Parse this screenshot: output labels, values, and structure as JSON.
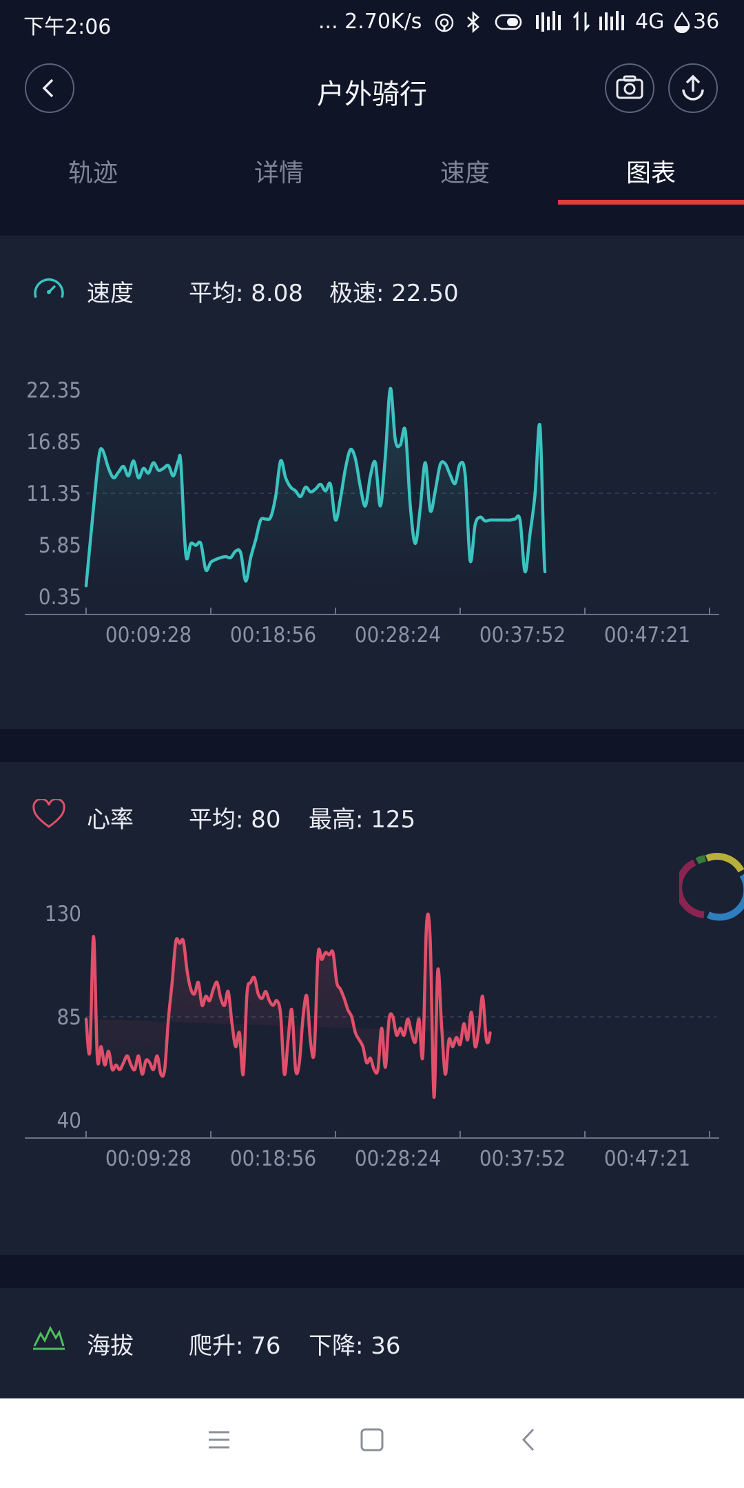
{
  "status_bar": {
    "time": "下午2:06",
    "net_speed": "... 2.70K/s",
    "network": "4G",
    "battery": "36"
  },
  "header": {
    "title": "户外骑行",
    "tabs": [
      {
        "label": "轨迹",
        "active": false
      },
      {
        "label": "详情",
        "active": false
      },
      {
        "label": "速度",
        "active": false
      },
      {
        "label": "图表",
        "active": true
      }
    ]
  },
  "speed_card": {
    "title": "速度",
    "avg": "平均: 8.08",
    "max": "极速: 22.50"
  },
  "heart_card": {
    "title": "心率",
    "avg": "平均: 80",
    "max": "最高: 125"
  },
  "altitude_card": {
    "title": "海拔",
    "climb": "爬升: 76",
    "descent": "下降: 36"
  },
  "colors": {
    "speed": "#3bc3c0",
    "heart": "#e0506a",
    "altitude": "#4fbf5d",
    "tab_active_bar": "#e53b3b"
  },
  "chart_data": [
    {
      "type": "line",
      "name": "speed",
      "yticks": [
        "22.35",
        "16.85",
        "11.35",
        "5.85",
        "0.35"
      ],
      "xticks": [
        "00:09:28",
        "00:18:56",
        "00:28:24",
        "00:37:52",
        "00:47:21"
      ],
      "ylim": [
        0.35,
        22.35
      ],
      "xlim_min": [
        0,
        50
      ],
      "x": [
        0,
        0.5,
        1,
        1.3,
        1.8,
        2.2,
        2.6,
        3,
        3.4,
        3.8,
        4.2,
        4.6,
        5,
        5.4,
        5.8,
        6.2,
        6.6,
        7,
        7.4,
        7.6,
        8,
        8.4,
        8.8,
        9.2,
        9.6,
        10,
        10.4,
        10.8,
        11.2,
        11.6,
        12,
        12.4,
        12.8,
        13.2,
        13.6,
        14,
        14.4,
        14.8,
        15.2,
        15.6,
        16,
        16.4,
        16.8,
        17.2,
        17.6,
        18,
        18.4,
        18.8,
        19.2,
        19.6,
        20,
        20.4,
        20.8,
        21.2,
        21.6,
        22,
        22.4,
        22.8,
        23.2,
        23.6,
        24,
        24.4,
        24.8,
        25.2,
        25.6,
        26,
        26.4,
        26.8,
        27.2,
        27.6,
        28,
        28.4,
        28.8,
        29.2,
        29.6,
        30,
        30.4,
        30.8,
        31.2,
        31.6,
        32,
        32.4,
        32.8,
        33.2,
        33.6,
        34,
        34.4,
        34.8,
        35.2,
        35.6,
        36,
        36.4,
        36.8,
        37.2,
        37.6,
        38,
        38.4,
        38.8,
        39.2,
        39.6,
        40,
        40.4,
        40.8,
        41.2,
        41.6,
        42,
        42.4,
        42.8,
        43.2,
        43.6,
        44,
        44.4,
        44.8,
        45.2,
        45.6,
        46,
        46.4,
        46.8,
        47.2,
        47.6,
        48,
        48.4,
        48.8,
        49.2,
        49.6,
        50
      ],
      "y": [
        1.5,
        8.5,
        15,
        16,
        14,
        13,
        13.6,
        14.2,
        13.2,
        14.8,
        13,
        14,
        13.5,
        14.6,
        13.8,
        14,
        14.3,
        13.2,
        14.8,
        14.5,
        4.8,
        6,
        5.8,
        6,
        3.2,
        4,
        4.3,
        4.5,
        4.6,
        4.5,
        5.2,
        5,
        2,
        4.5,
        6.4,
        8.5,
        8.6,
        8.8,
        11,
        14.8,
        13,
        12,
        11.6,
        11,
        12,
        11.5,
        11.8,
        12.3,
        11.6,
        12.3,
        8.5,
        10.8,
        14,
        16,
        15,
        12,
        10,
        13.2,
        14.6,
        10,
        15.3,
        22.5,
        17,
        16.5,
        18,
        10,
        6,
        9.8,
        14.6,
        9.5,
        11.6,
        14.4,
        14.5,
        13.3,
        12.4,
        14.5,
        13.3,
        4.2,
        8,
        8.8,
        8.4,
        8.5,
        8.5,
        8.5,
        8.5,
        8.5,
        8.6,
        8.5,
        3,
        7,
        11.2,
        18.5,
        3,
        12
      ]
    },
    {
      "type": "line",
      "name": "heart_rate",
      "yticks": [
        "130",
        "85",
        "40"
      ],
      "xticks": [
        "00:09:28",
        "00:18:56",
        "00:28:24",
        "00:37:52",
        "00:47:21"
      ],
      "ylim": [
        40,
        130
      ],
      "xlim_min": [
        0,
        50
      ],
      "x": [
        0,
        0.3,
        0.6,
        0.9,
        1.2,
        1.5,
        1.8,
        2.1,
        2.4,
        2.7,
        3,
        3.3,
        3.6,
        3.9,
        4.2,
        4.5,
        4.8,
        5.1,
        5.4,
        5.7,
        6,
        6.3,
        6.6,
        6.9,
        7.2,
        7.5,
        7.8,
        8.1,
        8.4,
        8.7,
        9,
        9.3,
        9.6,
        9.9,
        10.2,
        10.5,
        10.8,
        11.1,
        11.4,
        11.7,
        12,
        12.3,
        12.6,
        12.9,
        13.2,
        13.5,
        13.8,
        14.1,
        14.4,
        14.7,
        15,
        15.3,
        15.6,
        15.9,
        16.2,
        16.5,
        16.8,
        17.1,
        17.4,
        17.7,
        18,
        18.3,
        18.6,
        18.9,
        19.2,
        19.5,
        19.8,
        20.1,
        20.4,
        20.7,
        21,
        21.3,
        21.6,
        21.9,
        22.2,
        22.5,
        22.8,
        23.1,
        23.4,
        23.7,
        24,
        24.3,
        24.6,
        24.9,
        25.2,
        25.5,
        25.8,
        26.1,
        26.4,
        26.7,
        27,
        27.3,
        27.6,
        27.9,
        28.2,
        28.5,
        28.8,
        29.1,
        29.4,
        29.7,
        30,
        30.3,
        30.6,
        30.9,
        31.2,
        31.5,
        31.8,
        32.1,
        32.4,
        32.7,
        33,
        33.3,
        33.6,
        33.9,
        34.2,
        34.5,
        34.8,
        35.1,
        35.4,
        35.7,
        36,
        36.3,
        36.6,
        36.9,
        37.2,
        37.5,
        37.8,
        38.1,
        38.4,
        38.7,
        39,
        39.3,
        39.6,
        39.9,
        40.2,
        40.5,
        40.8,
        41.1,
        41.4,
        41.7,
        42,
        42.3,
        42.6,
        42.9,
        43.2,
        43.5,
        43.8,
        44.1,
        44.4,
        44.7,
        45,
        45.3,
        45.6,
        45.9,
        46.2,
        46.5,
        46.8,
        47.1,
        47.4,
        47.7,
        48,
        48.3,
        48.6,
        48.9,
        49.2,
        49.5,
        49.8,
        50
      ],
      "y": [
        84,
        70,
        120,
        67,
        72,
        64,
        70,
        62,
        64,
        62,
        65,
        68,
        64,
        62,
        68,
        60,
        66,
        65,
        62,
        68,
        60,
        62,
        84,
        100,
        118,
        117,
        118,
        105,
        97,
        95,
        100,
        90,
        94,
        92,
        97,
        100,
        93,
        90,
        96,
        82,
        72,
        78,
        60,
        95,
        100,
        102,
        95,
        93,
        96,
        92,
        90,
        92,
        86,
        60,
        75,
        88,
        62,
        65,
        85,
        94,
        74,
        70,
        112,
        110,
        113,
        112,
        113,
        100,
        97,
        93,
        88,
        85,
        78,
        75,
        72,
        65,
        67,
        62,
        62,
        80,
        63,
        84,
        85,
        77,
        80,
        77,
        84,
        78,
        74,
        84,
        68,
        125,
        118,
        50,
        105,
        82,
        60,
        75,
        72,
        76,
        73,
        82,
        75,
        87,
        72,
        80,
        94,
        75,
        78,
        100
      ]
    }
  ]
}
